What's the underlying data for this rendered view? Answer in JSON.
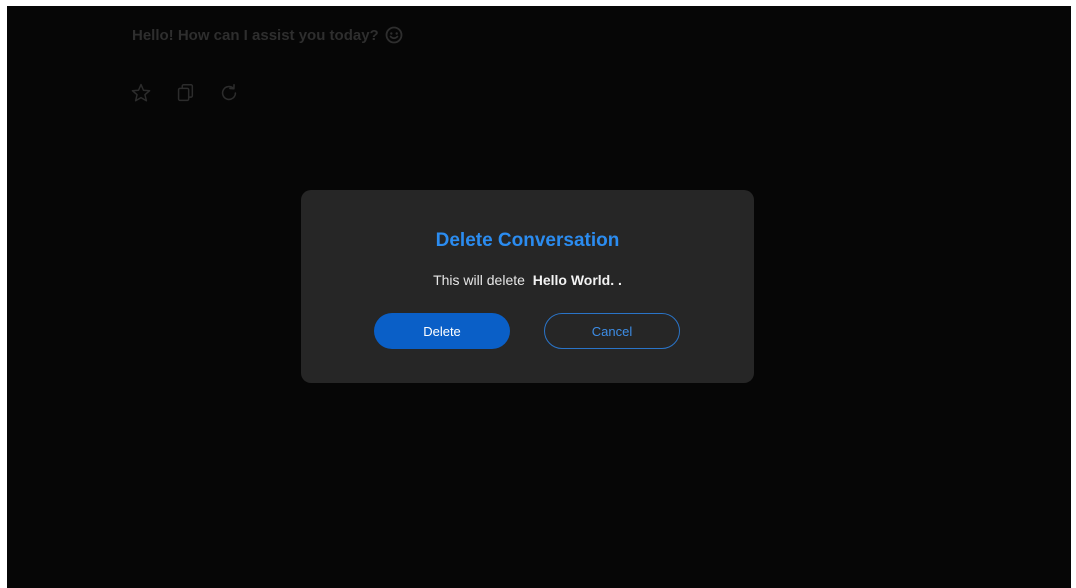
{
  "chat": {
    "message_text": "Hello! How can I assist you today?",
    "message_icon": "smile-emoji-icon",
    "actions": [
      {
        "icon": "star-icon"
      },
      {
        "icon": "copy-icon"
      },
      {
        "icon": "refresh-icon"
      }
    ]
  },
  "dialog": {
    "title": "Delete Conversation",
    "body_prefix": "This will delete",
    "conversation_name": "Hello World.",
    "body_suffix": ".",
    "delete_label": "Delete",
    "cancel_label": "Cancel"
  },
  "colors": {
    "background": "#060606",
    "dialog_bg": "#262626",
    "accent": "#2b8cf0",
    "delete_button": "#0a5fc7"
  }
}
